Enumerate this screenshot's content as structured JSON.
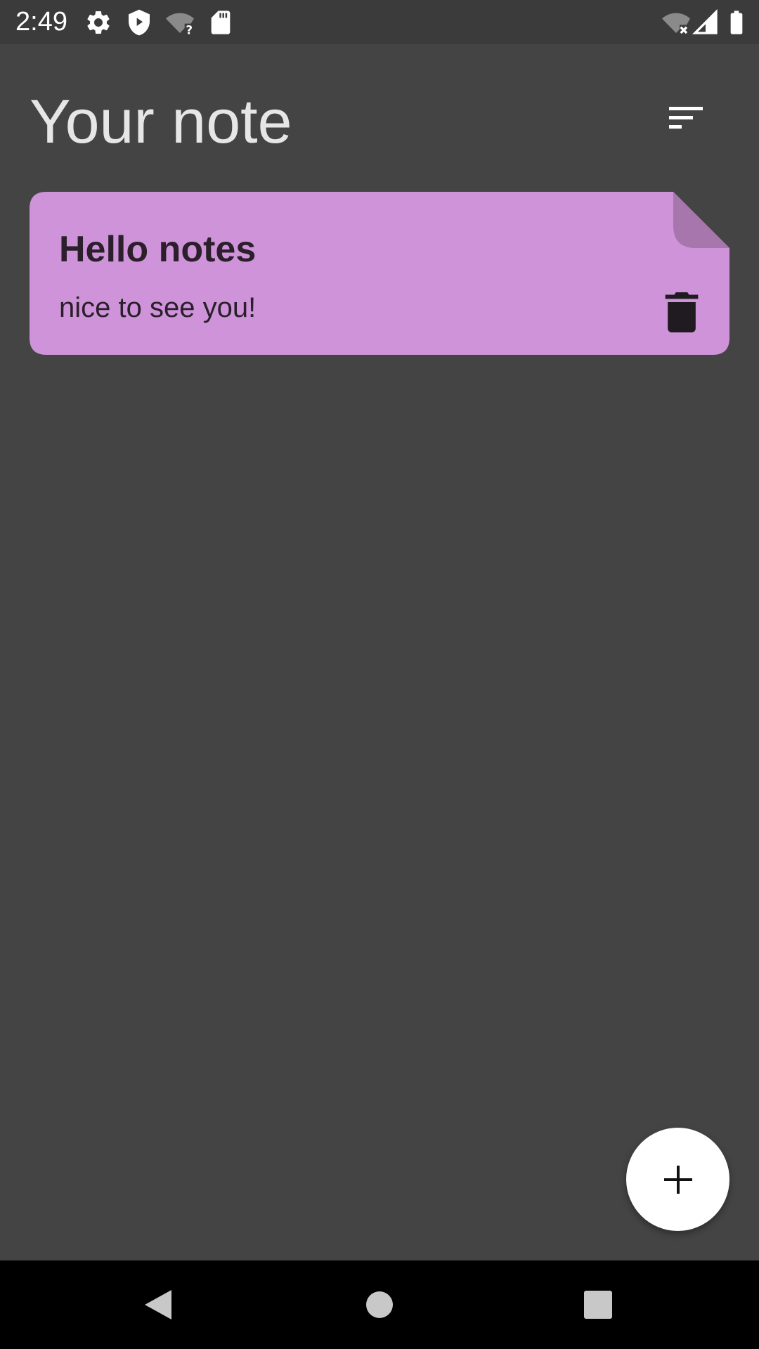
{
  "status_bar": {
    "time": "2:49",
    "left_icons": [
      "settings-icon",
      "shield-icon",
      "wifi-unknown-icon",
      "sd-card-icon"
    ],
    "right_icons": [
      "wifi-off-icon",
      "cellular-signal-icon",
      "battery-icon"
    ]
  },
  "header": {
    "title": "Your note",
    "sort_icon": "sort-icon"
  },
  "notes": [
    {
      "title": "Hello notes",
      "content": "nice to see you!",
      "color": "#ce93d8",
      "delete_icon": "trash-icon"
    }
  ],
  "fab": {
    "icon": "plus-icon"
  },
  "nav_bar": {
    "icons": [
      "back-icon",
      "home-icon",
      "recents-icon"
    ]
  },
  "colors": {
    "background": "#444444",
    "status_bar": "#3b3b3b",
    "note_card": "#ce93d8",
    "note_fold": "#a676ac",
    "fab": "#ffffff",
    "nav_bar": "#000000"
  }
}
